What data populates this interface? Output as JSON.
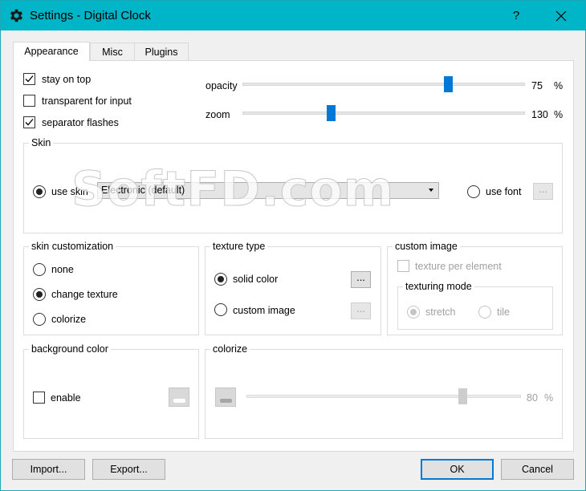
{
  "window": {
    "title": "Settings - Digital Clock",
    "icon": "gear-icon",
    "help_label": "?",
    "close_icon": "close-icon"
  },
  "tabs": [
    {
      "label": "Appearance",
      "active": true
    },
    {
      "label": "Misc",
      "active": false
    },
    {
      "label": "Plugins",
      "active": false
    }
  ],
  "general": {
    "stay_on_top": {
      "label": "stay on top",
      "checked": true
    },
    "transparent_for_input": {
      "label": "transparent for input",
      "checked": false
    },
    "separator_flashes": {
      "label": "separator flashes",
      "checked": true
    }
  },
  "sliders": {
    "opacity": {
      "label": "opacity",
      "value": "75",
      "unit": "%"
    },
    "zoom": {
      "label": "zoom",
      "value": "130",
      "unit": "%"
    }
  },
  "skin": {
    "title": "Skin",
    "use_skin_label": "use skin",
    "use_skin_selected": true,
    "selected_skin": "Electronic (default)",
    "use_font_label": "use font",
    "use_font_selected": false,
    "font_button_label": "..."
  },
  "skin_customization": {
    "title": "skin customization",
    "options": [
      {
        "label": "none",
        "selected": false
      },
      {
        "label": "change texture",
        "selected": true
      },
      {
        "label": "colorize",
        "selected": false
      }
    ]
  },
  "texture_type": {
    "title": "texture type",
    "solid_color_label": "solid color",
    "solid_color_selected": true,
    "solid_color_button": "...",
    "custom_image_label": "custom image",
    "custom_image_selected": false,
    "custom_image_button": "..."
  },
  "custom_image": {
    "title": "custom image",
    "texture_per_element_label": "texture per element",
    "texturing_mode_title": "texturing mode",
    "stretch_label": "stretch",
    "tile_label": "tile"
  },
  "background_color": {
    "title": "background color",
    "enable_label": "enable",
    "enabled": false
  },
  "colorize": {
    "title": "colorize",
    "value": "80",
    "unit": "%"
  },
  "footer": {
    "import_label": "Import...",
    "export_label": "Export...",
    "ok_label": "OK",
    "cancel_label": "Cancel"
  },
  "watermark": "SoftFD.com",
  "colors": {
    "titlebar": "#00b5c7",
    "accent": "#0078d7"
  }
}
